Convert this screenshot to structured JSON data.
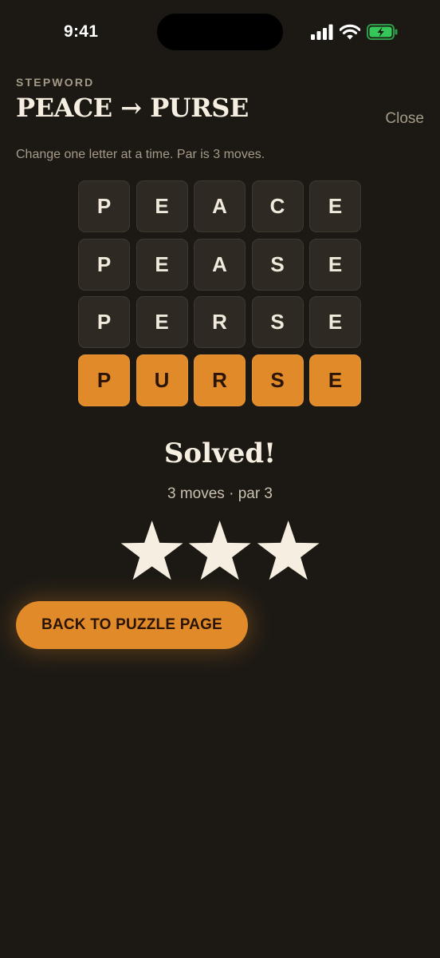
{
  "status_bar": {
    "time": "9:41",
    "icons": [
      "cellular-signal-icon",
      "wifi-icon",
      "battery-charging-icon"
    ],
    "battery_color": "#34c759"
  },
  "header": {
    "eyebrow": "STEPWORD",
    "title": "PEACE → PURSE",
    "close_label": "Close",
    "instructions": "Change one letter at a time. Par is 3 moves."
  },
  "board": {
    "rows": [
      {
        "letters": [
          "P",
          "E",
          "A",
          "C",
          "E"
        ],
        "state": "step"
      },
      {
        "letters": [
          "P",
          "E",
          "A",
          "S",
          "E"
        ],
        "state": "step"
      },
      {
        "letters": [
          "P",
          "E",
          "R",
          "S",
          "E"
        ],
        "state": "step"
      },
      {
        "letters": [
          "P",
          "U",
          "R",
          "S",
          "E"
        ],
        "state": "solved"
      }
    ]
  },
  "result": {
    "heading": "Solved!",
    "summary": "3 moves · par 3",
    "stars_earned": 3,
    "stars_total": 3
  },
  "cta": {
    "label": "BACK TO PUZZLE PAGE"
  },
  "colors": {
    "background": "#1c1914",
    "accent": "#e08a2a",
    "tile": "#2e2a23",
    "star": "#f6efe1"
  }
}
